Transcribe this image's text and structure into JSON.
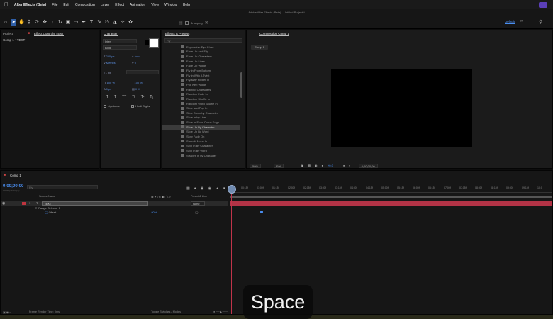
{
  "menubar": {
    "app": "After Effects (Beta)",
    "items": [
      "File",
      "Edit",
      "Composition",
      "Layer",
      "Effect",
      "Animation",
      "View",
      "Window",
      "Help"
    ]
  },
  "toolbar": {
    "doc_title": "Adobe After Effects (Beta) - Untitled Project *",
    "snapping": "Snapping",
    "workspace": "Default"
  },
  "project_panel": {
    "tab_project": "Project",
    "tab_effect_controls": "Effect Controls TEXT",
    "line": "Comp 1 • TEXT"
  },
  "character_panel": {
    "title": "Character",
    "font": "Inter",
    "style": "Bold",
    "size": "250 px",
    "tracking_mode": "Metrics",
    "leading": "Auto",
    "kerning": "0",
    "unit": "- px",
    "vert_scale": "100 %",
    "horiz_scale": "100 %",
    "baseline": "0 px",
    "tsume": "0 %",
    "format_buttons": [
      "T",
      "T",
      "TT",
      "Tt",
      "T¹",
      "T₁"
    ],
    "ligatures": "Ligatures",
    "hindi_digits": "Hindi Digits"
  },
  "effects_panel": {
    "title": "Effects & Presets",
    "search": "Fly",
    "items": [
      "Expressive Eye Chart",
      "Fade Up And Flip",
      "Fade Up Characters",
      "Fade Up Lines",
      "Fade Up Words",
      "Fly In From Bottom",
      "Fly In With A Twist",
      "Flyaway Flicker In",
      "Pop Kerl Words",
      "Raining Characters",
      "Random Fade In",
      "Random Shuffle In",
      "Random Word Shuffle In",
      "Slide and Pop In",
      "Slide Down by Character",
      "Slide in by Line",
      "Slide In From Curve Edge",
      "Slide Up By Character",
      "Slide Up By Word",
      "Slow Fade On",
      "Smooth Move In",
      "Spin In By Character",
      "Spin In By Word",
      "Straight In by Character"
    ],
    "selected_index": 17
  },
  "comp_panel": {
    "title": "Composition Comp 1",
    "chip": "Comp 1",
    "zoom": "50%",
    "resolution": "Full",
    "exposure": "+0.0",
    "timecode": "0;00;00;00"
  },
  "timeline": {
    "tab": "Comp 1",
    "time": "0;00;00;00",
    "fps": "00000 (29.97 fps)",
    "search": "Fly",
    "col_source": "Source Name",
    "col_parent": "Parent & Link",
    "layer_num": "1",
    "layer_name": "TEXT",
    "parent": "None",
    "range_selector": "Range Selector 1",
    "offset_label": "Offset",
    "offset_value": "-80%",
    "ruler": [
      "00:15f",
      "01:00f",
      "01:15f",
      "02:00f",
      "02:15f",
      "03:00f",
      "03:15f",
      "04:00f",
      "04:15f",
      "05:00f",
      "05:15f",
      "06:00f",
      "06:15f",
      "07:00f",
      "07:15f",
      "08:00f",
      "08:15f",
      "09:00f",
      "09:15f",
      "10:0"
    ],
    "render_time": "Frame Render Time: 0ms",
    "toggle_mode": "Toggle Switches / Modes"
  },
  "key_overlay": "Space"
}
